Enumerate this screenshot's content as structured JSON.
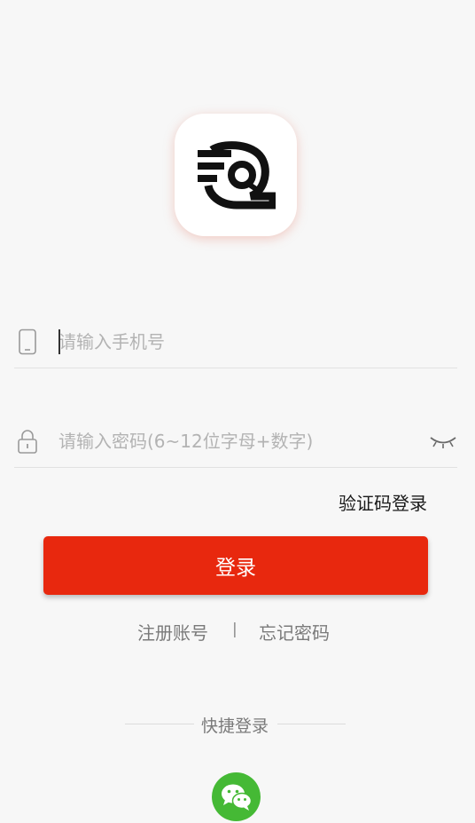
{
  "app": {
    "logo": "app-logo-icon"
  },
  "phone_field": {
    "icon": "phone-icon",
    "placeholder": "请输入手机号",
    "value": ""
  },
  "password_field": {
    "icon": "lock-icon",
    "placeholder": "请输入密码(6~12位字母+数字)",
    "value": "",
    "toggle_icon": "eye-closed-icon"
  },
  "sms_login_label": "验证码登录",
  "login_button_label": "登录",
  "links": {
    "register": "注册账号",
    "separator": "|",
    "forgot_password": "忘记密码"
  },
  "quick_login": {
    "label": "快捷登录",
    "providers": [
      {
        "icon": "wechat-icon",
        "color": "#45b935"
      }
    ]
  },
  "colors": {
    "accent": "#e8280e",
    "wechat": "#45b935"
  }
}
